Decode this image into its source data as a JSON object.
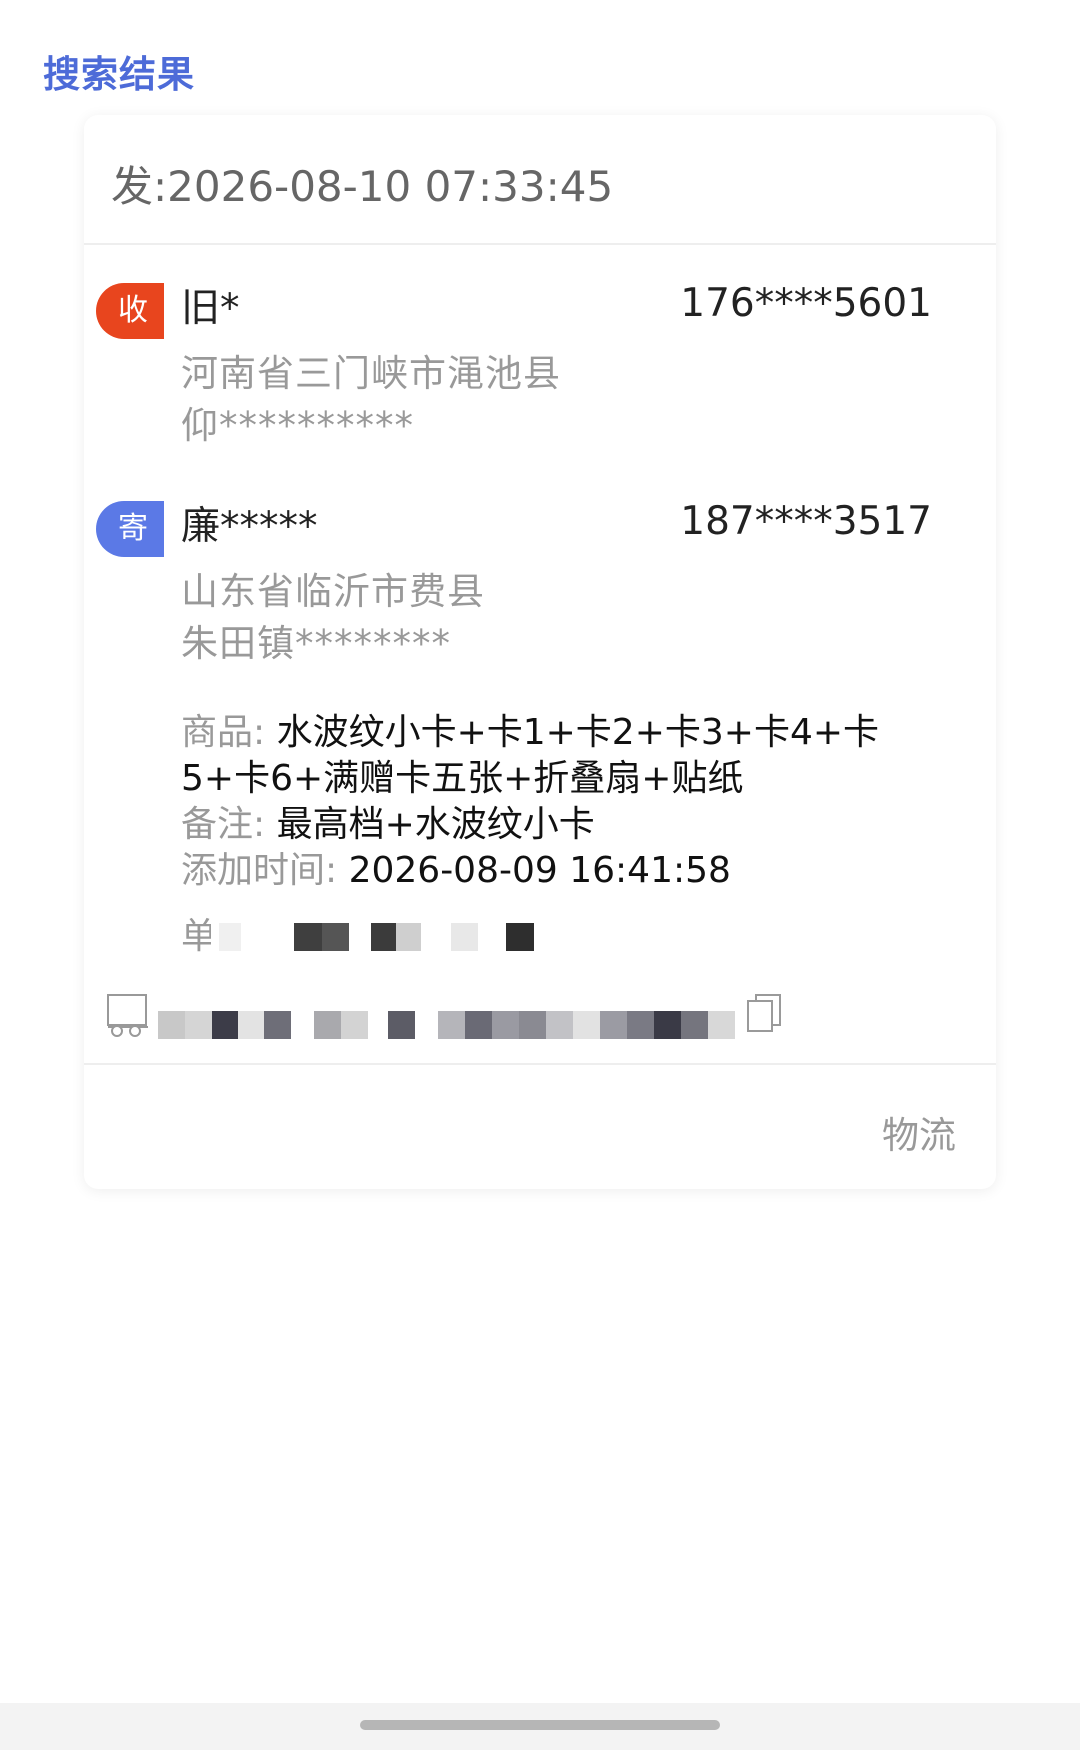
{
  "header": {
    "title": "搜索结果"
  },
  "order": {
    "send_time": "发:2026-08-10 07:33:45",
    "receiver": {
      "badge": "收",
      "name": "旧*",
      "phone": "176****5601",
      "address_line1": "河南省三门峡市渑池县",
      "address_line2": "仰**********"
    },
    "sender": {
      "badge": "寄",
      "name": "廉*****",
      "phone": "187****3517",
      "address_line1": "山东省临沂市费县",
      "address_line2": "朱田镇********"
    },
    "goods_label": "商品: ",
    "goods_value": "水波纹小卡+卡1+卡2+卡3+卡4+卡5+卡6+满赠卡五张+折叠扇+贴纸",
    "remark_label": "备注: ",
    "remark_value": "最高档+水波纹小卡",
    "added_time_label": "添加时间: ",
    "added_time_value": "2026-08-09 16:41:58",
    "waybill_label": "单",
    "logistics_button": "物流"
  },
  "icons": {
    "truck": "truck-icon",
    "copy": "copy-icon"
  },
  "colors": {
    "title_blue": "#4d6bd8",
    "receive_badge": "#e8451e",
    "send_badge": "#5b79e6"
  }
}
